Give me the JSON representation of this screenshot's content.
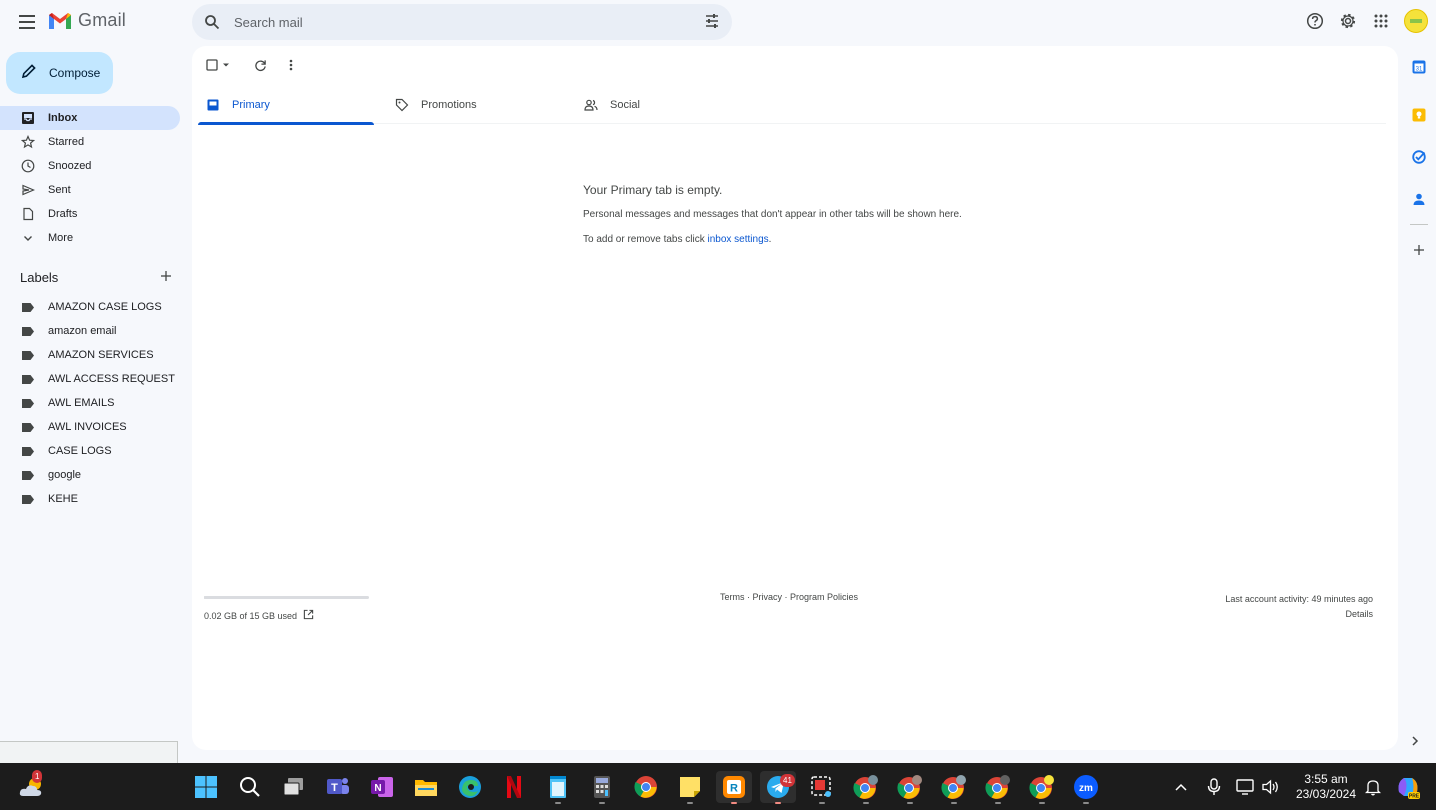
{
  "app": {
    "name": "Gmail"
  },
  "search": {
    "placeholder": "Search mail"
  },
  "compose": {
    "label": "Compose"
  },
  "nav": {
    "items": [
      {
        "label": "Inbox",
        "icon": "inbox-icon",
        "active": true
      },
      {
        "label": "Starred",
        "icon": "star-icon"
      },
      {
        "label": "Snoozed",
        "icon": "clock-icon"
      },
      {
        "label": "Sent",
        "icon": "send-icon"
      },
      {
        "label": "Drafts",
        "icon": "draft-icon"
      },
      {
        "label": "More",
        "icon": "chevron-down-icon"
      }
    ]
  },
  "labels": {
    "title": "Labels",
    "items": [
      "AMAZON CASE LOGS",
      "amazon email",
      "AMAZON SERVICES",
      "AWL ACCESS REQUEST",
      "AWL EMAILS",
      "AWL INVOICES",
      "CASE LOGS",
      "google",
      "KEHE"
    ]
  },
  "tabs": [
    {
      "label": "Primary",
      "icon": "inbox-icon",
      "active": true
    },
    {
      "label": "Promotions",
      "icon": "tag-icon"
    },
    {
      "label": "Social",
      "icon": "people-icon"
    }
  ],
  "empty_state": {
    "title": "Your Primary tab is empty.",
    "line1": "Personal messages and messages that don't appear in other tabs will be shown here.",
    "line2_prefix": "To add or remove tabs click ",
    "line2_link": "inbox settings",
    "line2_suffix": "."
  },
  "storage": {
    "text": "0.02 GB of 15 GB used",
    "fraction": 0.0013
  },
  "footer": {
    "terms": "Terms",
    "privacy": "Privacy",
    "policies": "Program Policies",
    "sep": " · ",
    "activity": "Last account activity: 49 minutes ago",
    "details": "Details"
  },
  "taskbar": {
    "weather_badge": "1",
    "telegram_badge": "41",
    "time": "3:55 am",
    "date": "23/03/2024"
  },
  "colors": {
    "accent": "#0b57d0",
    "compose_bg": "#c2e7ff",
    "active_nav": "#d3e3fd",
    "background": "#f6f8fc"
  }
}
